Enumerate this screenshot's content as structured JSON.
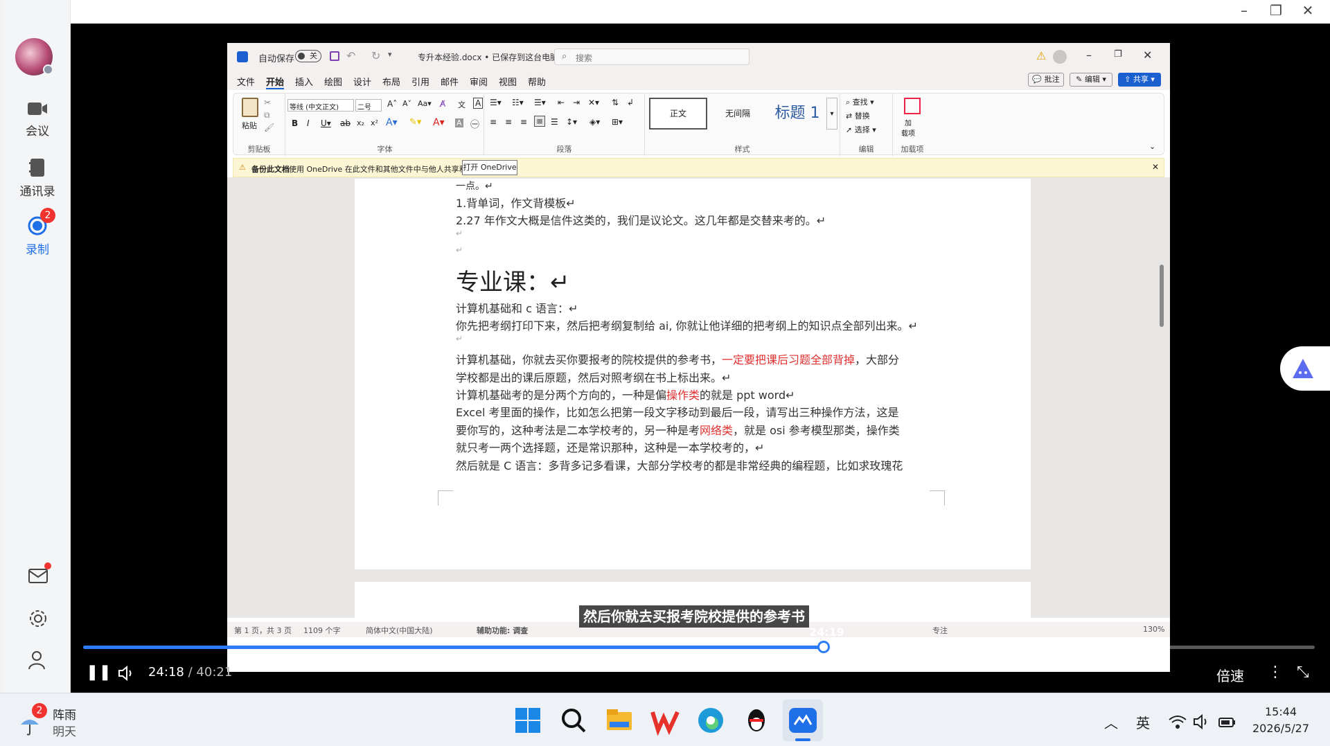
{
  "sidebar": {
    "items": [
      {
        "label": "会议"
      },
      {
        "label": "通讯录"
      },
      {
        "label": "录制",
        "badge": "2"
      }
    ]
  },
  "word": {
    "autosave_label": "自动保存",
    "autosave_state": "关",
    "doc_title": "专升本经验.docx • 已保存到这台电脑",
    "search_placeholder": "搜索",
    "menu": [
      "文件",
      "开始",
      "插入",
      "绘图",
      "设计",
      "布局",
      "引用",
      "邮件",
      "审阅",
      "视图",
      "帮助"
    ],
    "buttons": {
      "comment": "批注",
      "edit": "编辑",
      "share": "共享"
    },
    "ribbon": {
      "paste": "粘贴",
      "clipboard": "剪贴板",
      "font_name": "等线 (中文正文)",
      "font_size": "二号",
      "font_group": "字体",
      "paragraph_group": "段落",
      "styles": [
        "正文",
        "无间隔",
        "标题 1"
      ],
      "styles_group": "样式",
      "find": "查找",
      "replace": "替换",
      "select": "选择",
      "edit_group": "编辑",
      "addins": "加载项",
      "addins_btn": "加\n载项"
    },
    "notice": {
      "title": "备份此文档",
      "text": "使用 OneDrive 在此文件和其他文件中与他人共享和协作。",
      "button": "打开 OneDrive"
    },
    "doc_lines": {
      "l0": "一点。↵",
      "l1": "1.背单词，作文背模板↵",
      "l2": "2.27 年作文大概是信件这类的，我们是议论文。这几年都是交替来考的。↵",
      "l3": "↵",
      "l4": "↵",
      "heading": "专业课：↵",
      "l5": "计算机基础和 c 语言：↵",
      "l6": "你先把考纲打印下来，然后把考纲复制给 ai, 你就让他详细的把考纲上的知识点全部列出来。↵",
      "l7": "↵",
      "l8a": "计算机基础，你就去买你要报考的院校提供的参考书，",
      "l8b": "一定要把课后习题全部背掉",
      "l8c": "，大部分",
      "l9": "学校都是出的课后原题，然后对照考纲在书上标出来。↵",
      "l10a": "计算机基础考的是分两个方向的，一种是偏",
      "l10b": "操作类",
      "l10c": "的就是 ppt word↵",
      "l11": "Excel 考里面的操作，比如怎么把第一段文字移动到最后一段，请写出三种操作方法，这是",
      "l12a": "要你写的，这种考法是二本学校考的，另一种是考",
      "l12b": "网络类",
      "l12c": "，就是 osi 参考模型那类，操作类",
      "l13": "就只考一两个选择题，还是常识那种，这种是一本学校考的，↵",
      "l14": "然后就是 C 语言：多背多记多看课，大部分学校考的都是非常经典的编程题，比如求玫瑰花"
    },
    "status": {
      "page": "第 1 页，共 3 页",
      "words": "1109 个字",
      "lang": "简体中文(中国大陆)",
      "access": "辅助功能: 调查",
      "focus": "专注",
      "zoom": "130%"
    }
  },
  "player": {
    "subtitle": "然后你就去买报考院校提供的参考书",
    "hover_time": "24:19",
    "current_time": "24:18",
    "total_time": "40:21",
    "progress": 0.601,
    "speed_label": "倍速"
  },
  "taskbar": {
    "weather_badge": "2",
    "weather": "阵雨",
    "weather_day": "明天",
    "ime": "英",
    "time": "15:44",
    "date": "2026/5/27"
  },
  "colors": {
    "accent": "#1f6fe8",
    "progress": "#2b7cf6",
    "word_share": "#1a5fd0",
    "doc_red": "#e03030"
  }
}
